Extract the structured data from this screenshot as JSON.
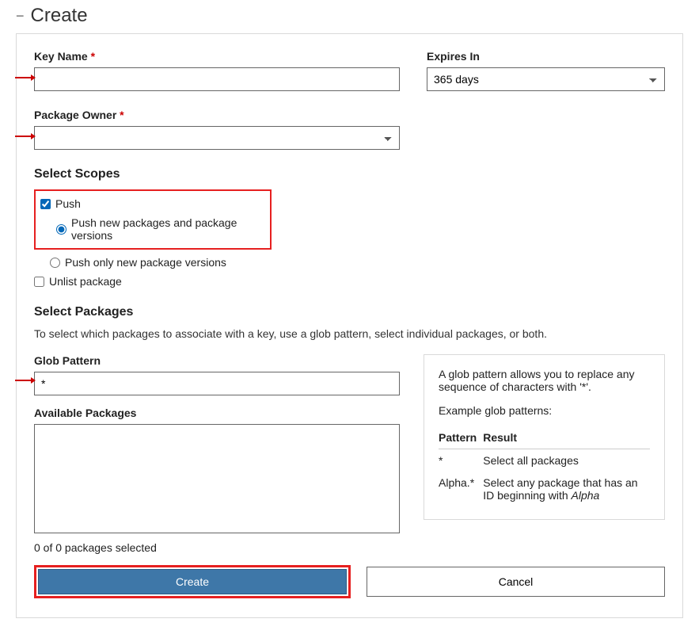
{
  "header": {
    "collapse_glyph": "−",
    "title": "Create"
  },
  "keyName": {
    "label": "Key Name",
    "required": "*",
    "value": ""
  },
  "expiresIn": {
    "label": "Expires In",
    "selected": "365 days"
  },
  "packageOwner": {
    "label": "Package Owner",
    "required": "*",
    "selected": ""
  },
  "scopes": {
    "heading": "Select Scopes",
    "push": {
      "label": "Push",
      "checked": true
    },
    "pushNew": {
      "label": "Push new packages and package versions",
      "checked": true
    },
    "pushOnly": {
      "label": "Push only new package versions",
      "checked": false
    },
    "unlist": {
      "label": "Unlist package",
      "checked": false
    }
  },
  "packages": {
    "heading": "Select Packages",
    "help": "To select which packages to associate with a key, use a glob pattern, select individual packages, or both.",
    "globLabel": "Glob Pattern",
    "globValue": "*",
    "availableLabel": "Available Packages",
    "countText": "0 of 0 packages selected"
  },
  "globHelp": {
    "intro": "A glob pattern allows you to replace any sequence of characters with '*'.",
    "exampleHeading": "Example glob patterns:",
    "headers": {
      "pattern": "Pattern",
      "result": "Result"
    },
    "rows": [
      {
        "pattern": "*",
        "result": "Select all packages"
      },
      {
        "pattern": "Alpha.*",
        "resultPrefix": "Select any package that has an ID beginning with ",
        "resultEm": "Alpha"
      }
    ]
  },
  "buttons": {
    "create": "Create",
    "cancel": "Cancel"
  }
}
